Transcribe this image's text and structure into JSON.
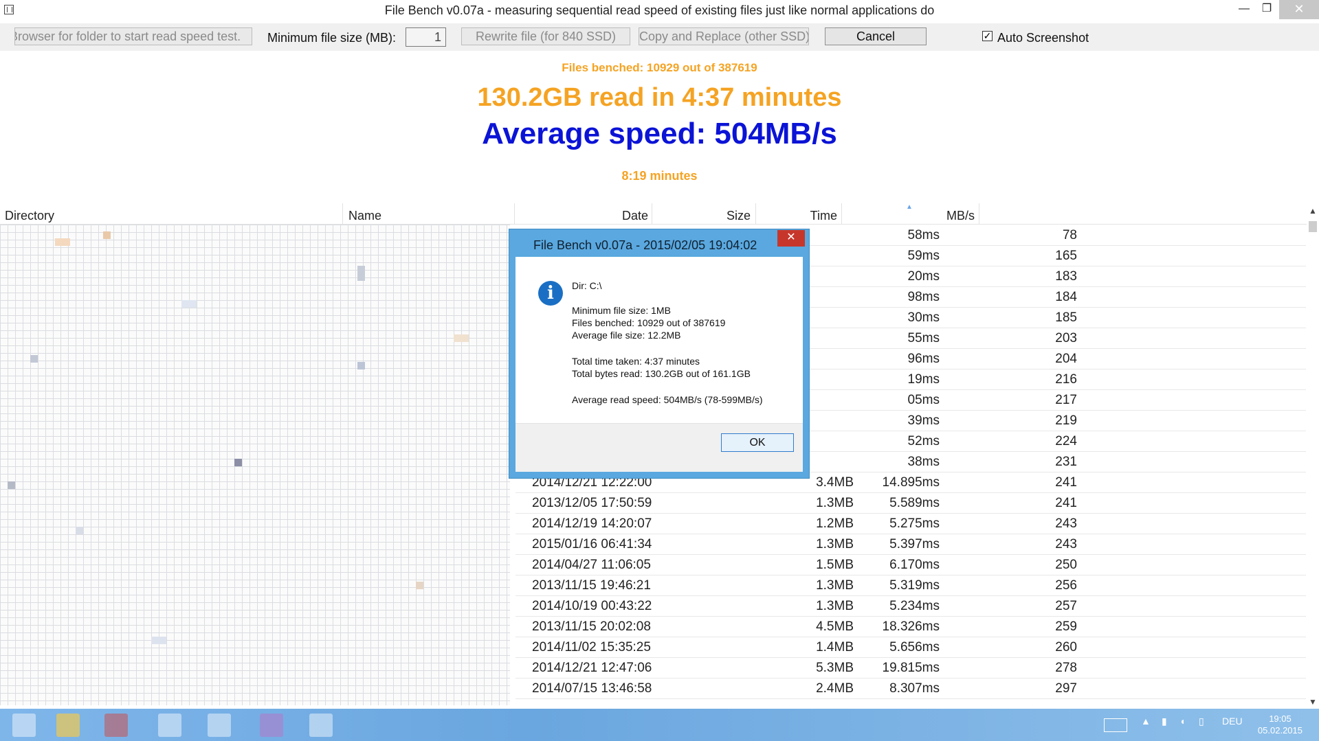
{
  "window": {
    "title": "File Bench v0.07a - measuring sequential read speed of existing files just like normal applications do",
    "minimize": "—",
    "maximize": "❐",
    "close": "✕"
  },
  "toolbar": {
    "browse_label": "Browser for folder to start read speed test.",
    "min_size_label": "Minimum file size (MB):",
    "min_size_value": "1",
    "rewrite_label": "Rewrite file (for 840 SSD)",
    "copy_replace_label": "Copy and Replace (other SSD)",
    "cancel_label": "Cancel",
    "auto_screenshot_label": "Auto Screenshot",
    "auto_screenshot_checked": "✓"
  },
  "summary": {
    "files_benched": "Files benched: 10929 out of 387619",
    "read_total": "130.2GB read in  4:37 minutes",
    "avg_speed": "Average speed: 504MB/s",
    "elapsed": "8:19 minutes"
  },
  "columns": {
    "directory": "Directory",
    "name": "Name",
    "date": "Date",
    "size": "Size",
    "time": "Time",
    "mbs": "MB/s"
  },
  "rows": [
    {
      "date": "",
      "size": "",
      "time": "58ms",
      "mbs": "78"
    },
    {
      "date": "",
      "size": "",
      "time": "59ms",
      "mbs": "165"
    },
    {
      "date": "",
      "size": "",
      "time": "20ms",
      "mbs": "183"
    },
    {
      "date": "",
      "size": "",
      "time": "98ms",
      "mbs": "184"
    },
    {
      "date": "",
      "size": "",
      "time": "30ms",
      "mbs": "185"
    },
    {
      "date": "",
      "size": "",
      "time": "55ms",
      "mbs": "203"
    },
    {
      "date": "",
      "size": "",
      "time": "96ms",
      "mbs": "204"
    },
    {
      "date": "",
      "size": "",
      "time": "19ms",
      "mbs": "216"
    },
    {
      "date": "",
      "size": "",
      "time": "05ms",
      "mbs": "217"
    },
    {
      "date": "",
      "size": "",
      "time": "39ms",
      "mbs": "219"
    },
    {
      "date": "",
      "size": "",
      "time": "52ms",
      "mbs": "224"
    },
    {
      "date": "",
      "size": "",
      "time": "38ms",
      "mbs": "231"
    },
    {
      "date": "2014/12/21 12:22:00",
      "size": "3.4MB",
      "time": "14.895ms",
      "mbs": "241"
    },
    {
      "date": "2013/12/05 17:50:59",
      "size": "1.3MB",
      "time": "5.589ms",
      "mbs": "241"
    },
    {
      "date": "2014/12/19 14:20:07",
      "size": "1.2MB",
      "time": "5.275ms",
      "mbs": "243"
    },
    {
      "date": "2015/01/16 06:41:34",
      "size": "1.3MB",
      "time": "5.397ms",
      "mbs": "243"
    },
    {
      "date": "2014/04/27 11:06:05",
      "size": "1.5MB",
      "time": "6.170ms",
      "mbs": "250"
    },
    {
      "date": "2013/11/15 19:46:21",
      "size": "1.3MB",
      "time": "5.319ms",
      "mbs": "256"
    },
    {
      "date": "2014/10/19 00:43:22",
      "size": "1.3MB",
      "time": "5.234ms",
      "mbs": "257"
    },
    {
      "date": "2013/11/15 20:02:08",
      "size": "4.5MB",
      "time": "18.326ms",
      "mbs": "259"
    },
    {
      "date": "2014/11/02 15:35:25",
      "size": "1.4MB",
      "time": "5.656ms",
      "mbs": "260"
    },
    {
      "date": "2014/12/21 12:47:06",
      "size": "5.3MB",
      "time": "19.815ms",
      "mbs": "278"
    },
    {
      "date": "2014/07/15 13:46:58",
      "size": "2.4MB",
      "time": "8.307ms",
      "mbs": "297"
    }
  ],
  "dialog": {
    "title": "File Bench v0.07a  -  2015/02/05 19:04:02",
    "close": "✕",
    "dir": "Dir: C:\\",
    "min_size": "Minimum file size: 1MB",
    "files_benched": "Files benched: 10929 out of 387619",
    "avg_file_size": "Average file size: 12.2MB",
    "total_time": "Total time taken:  4:37 minutes",
    "total_bytes": "Total bytes read: 130.2GB out of 161.1GB",
    "avg_read": "Average read speed: 504MB/s  (78-599MB/s)",
    "ok_label": "OK"
  },
  "taskbar": {
    "language": "DEU",
    "time": "19:05",
    "date": "05.02.2015"
  },
  "colors": {
    "orange": "#f5a323",
    "blue": "#0b13d6",
    "dialog_frame": "#5aa8df",
    "close_red": "#c7362b"
  }
}
